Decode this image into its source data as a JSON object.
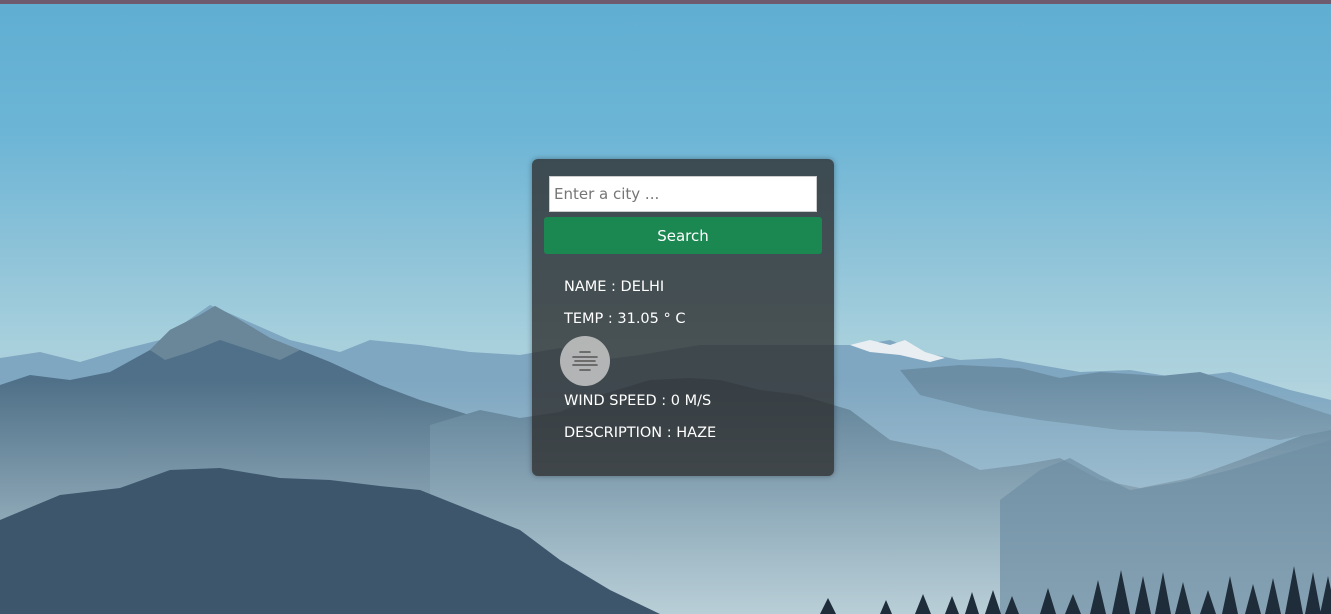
{
  "search": {
    "placeholder": "Enter a city ...",
    "value": "",
    "button_label": "Search"
  },
  "weather": {
    "name_label": "NAME : DELHI",
    "temp_label": "TEMP : 31.05 ° C",
    "icon": "haze-icon",
    "wind_label": "WIND SPEED : 0 M/S",
    "description_label": "DESCRIPTION : HAZE"
  },
  "colors": {
    "button": "#1b8852",
    "card": "rgba(45,45,45,0.78)",
    "sky_top": "#5faed2",
    "top_strip": "#6e5c6e"
  }
}
